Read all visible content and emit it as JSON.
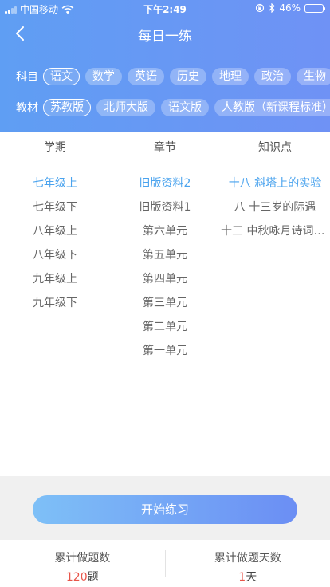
{
  "status_bar": {
    "carrier": "中国移动",
    "time": "下午2:49",
    "battery": "46%",
    "battery_level": 0.46
  },
  "nav": {
    "title": "每日一练",
    "back_icon": "chevron-left-icon"
  },
  "subject": {
    "label": "科目",
    "items": [
      "语文",
      "数学",
      "英语",
      "历史",
      "地理",
      "政治",
      "生物"
    ],
    "selected": 0
  },
  "textbook": {
    "label": "教材",
    "items": [
      "苏教版",
      "北师大版",
      "语文版",
      "人教版（新课程标准）"
    ],
    "selected": 0
  },
  "tabs": [
    "学期",
    "章节",
    "知识点"
  ],
  "columns": {
    "semester": [
      "七年级上",
      "七年级下",
      "八年级上",
      "八年级下",
      "九年级上",
      "九年级下"
    ],
    "chapter": [
      "旧版资料2",
      "旧版资料1",
      "第六单元",
      "第五单元",
      "第四单元",
      "第三单元",
      "第二单元",
      "第一单元"
    ],
    "knowledge": [
      "十八 斜塔上的实验",
      "八 十三岁的际遇",
      "十三 中秋咏月诗词三首"
    ]
  },
  "start_button": "开始练习",
  "stats": {
    "questions_label": "累计做题数",
    "questions_value": "120",
    "questions_unit": "题",
    "days_label": "累计做题天数",
    "days_value": "1",
    "days_unit": "天"
  },
  "colors": {
    "header": "#6a98f4",
    "active": "#4aa3ee",
    "stat_number": "#e8554a"
  }
}
